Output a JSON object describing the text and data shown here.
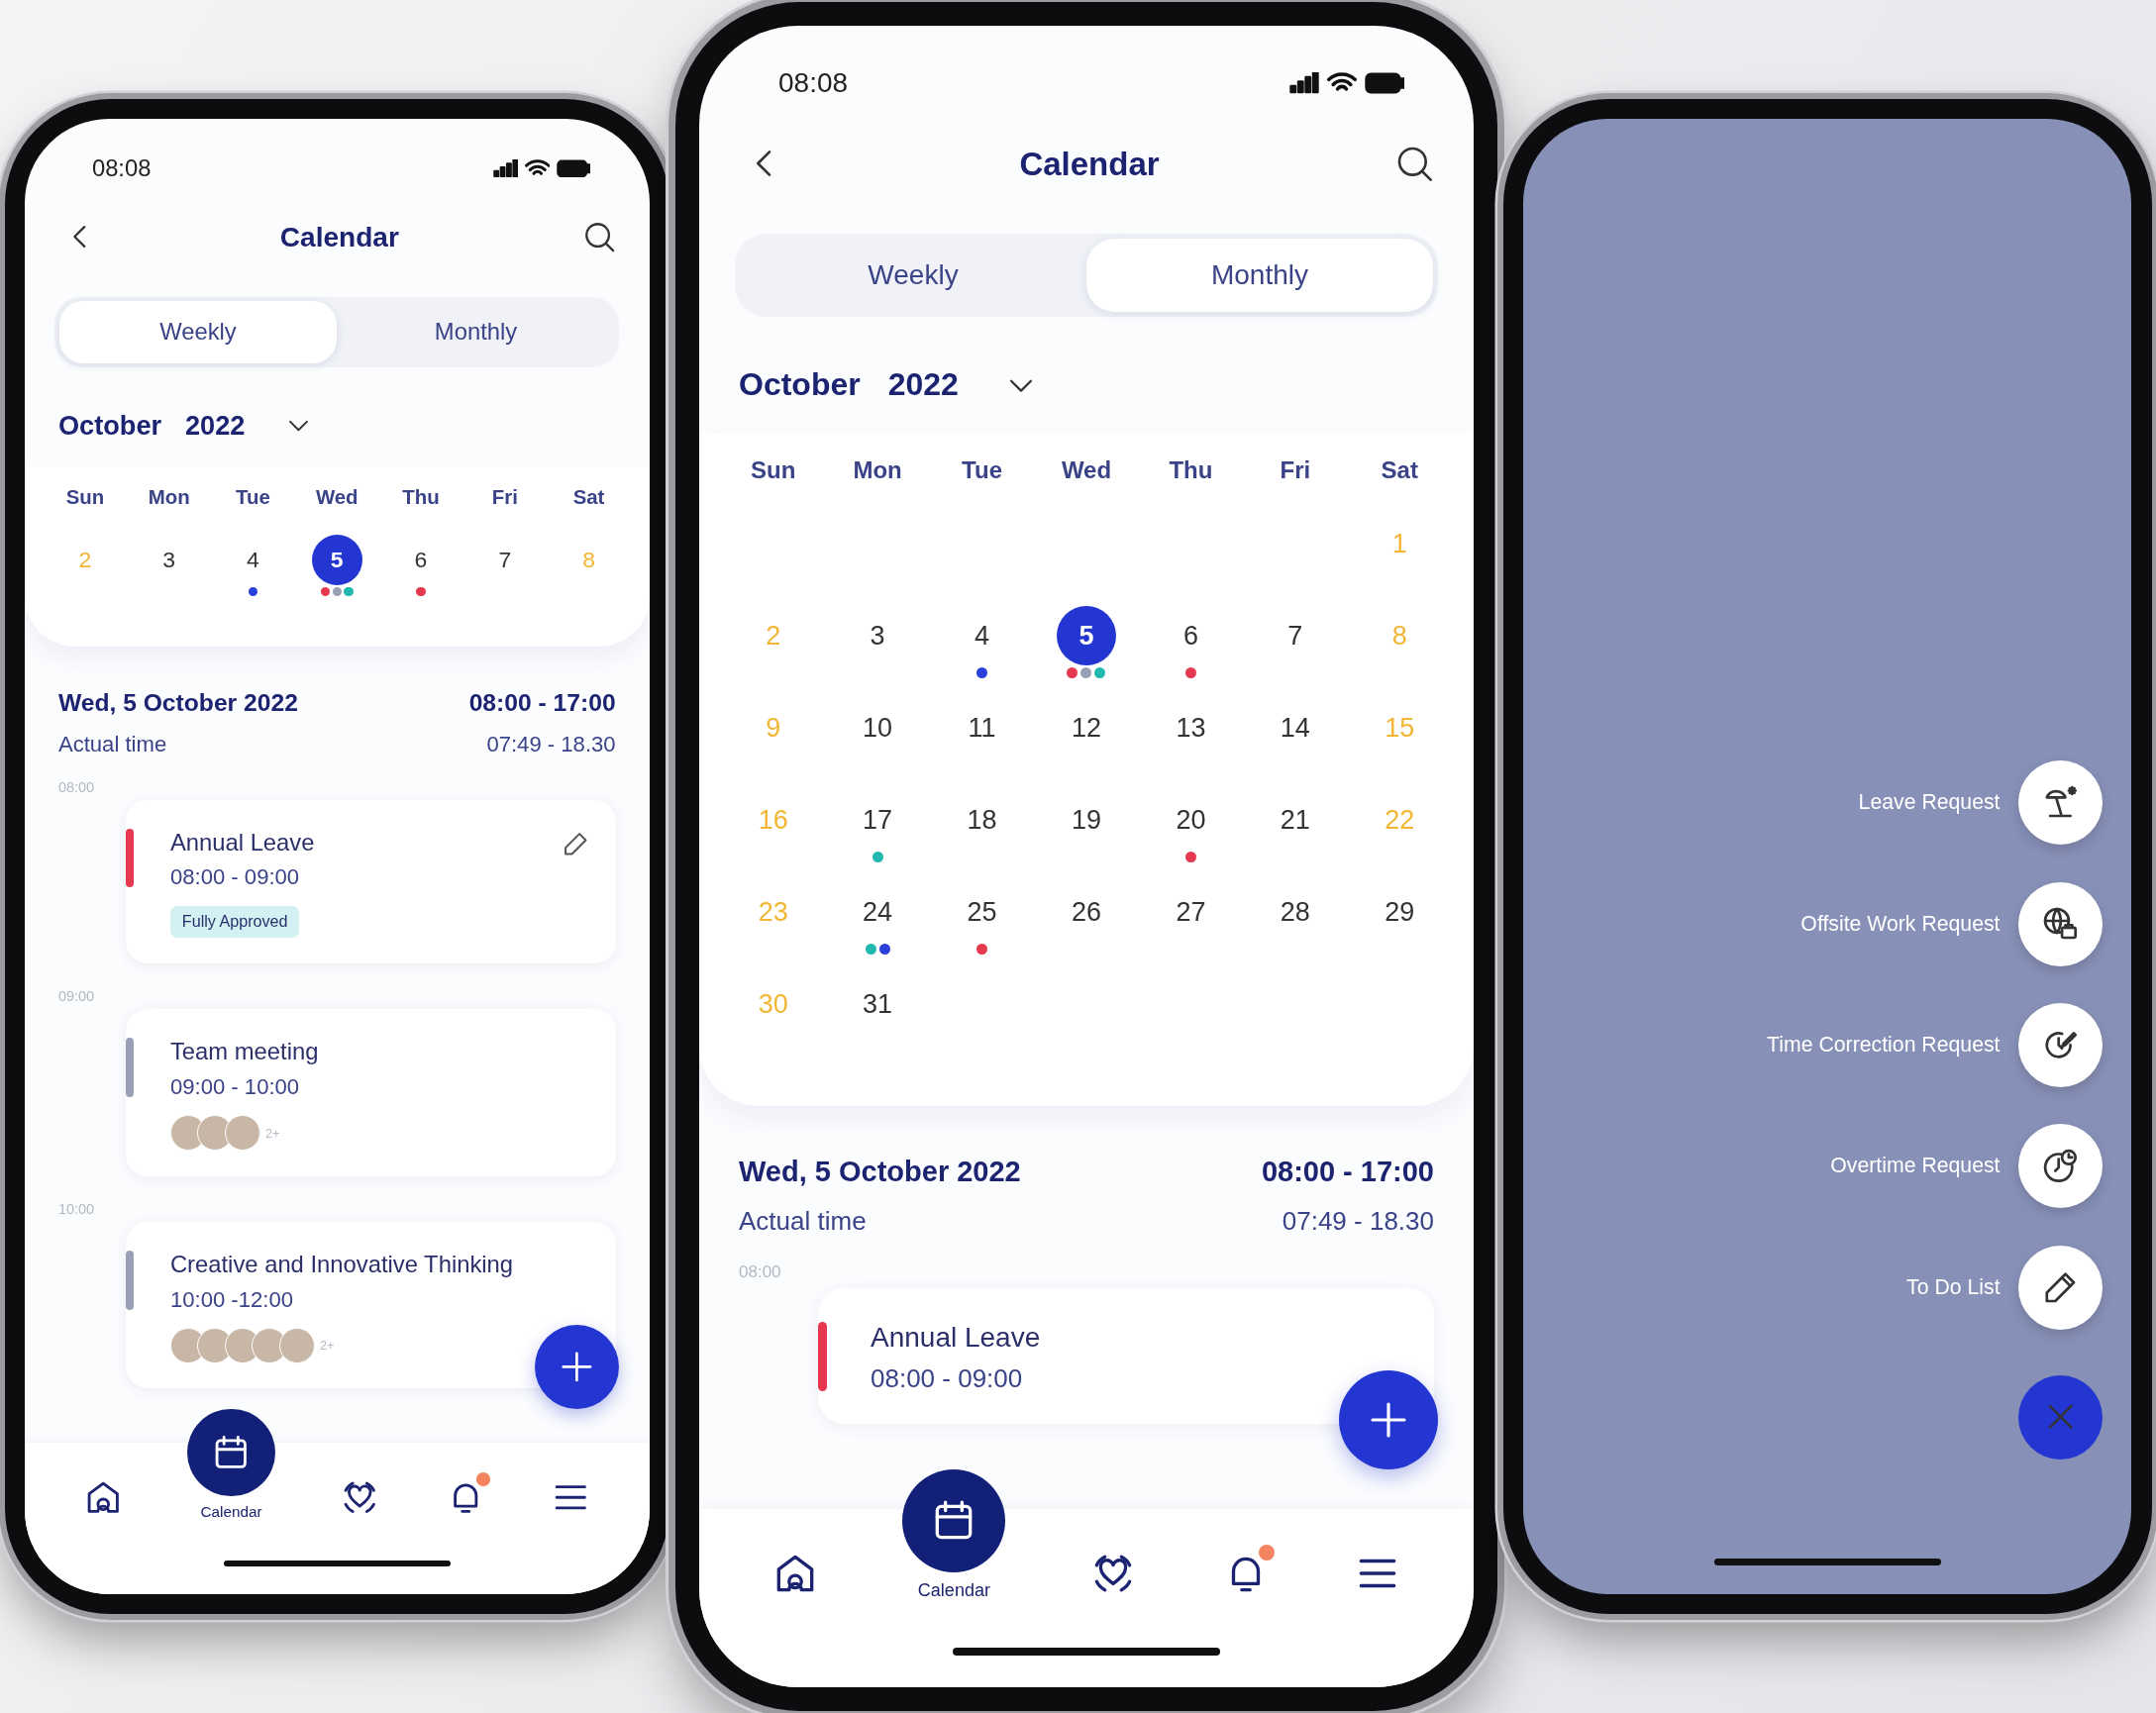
{
  "phones": [
    {
      "kind": "weekly",
      "status_time": "08:08",
      "title": "Calendar",
      "tabs": [
        {
          "label": "Weekly",
          "selected": true
        },
        {
          "label": "Monthly",
          "selected": false
        }
      ],
      "month": "October",
      "year": "2022",
      "weekdays": [
        "Sun",
        "Mon",
        "Tue",
        "Wed",
        "Thu",
        "Fri",
        "Sat"
      ],
      "weeks": [
        [
          {
            "kind": "day",
            "label": "2",
            "weekend": true,
            "selected": false
          },
          {
            "kind": "day",
            "label": "3",
            "weekend": false,
            "selected": false
          },
          {
            "kind": "day",
            "label": "4",
            "weekend": false,
            "selected": false,
            "dots": [
              {
                "color": "#2a40d8"
              }
            ]
          },
          {
            "kind": "day",
            "label": "5",
            "weekend": false,
            "selected": true,
            "dots": [
              {
                "color": "#e5394f"
              },
              {
                "color": "#9aa0b5"
              },
              {
                "color": "#21b8b0"
              }
            ]
          },
          {
            "kind": "day",
            "label": "6",
            "weekend": false,
            "selected": false,
            "dots": [
              {
                "color": "#e5394f"
              }
            ]
          },
          {
            "kind": "day",
            "label": "7",
            "weekend": false,
            "selected": false
          },
          {
            "kind": "day",
            "label": "8",
            "weekend": true,
            "selected": false
          }
        ]
      ],
      "day_title": "Wed, 5 October 2022",
      "planned": "08:00 - 17:00",
      "actual_label": "Actual time",
      "actual": "07:49 - 18.30",
      "schedule": [
        {
          "hour": "08:00",
          "title": "Annual Leave",
          "time": "08:00 - 09:00",
          "color": "#e5394f",
          "editable": true,
          "status": "Fully Approved"
        },
        {
          "hour": "09:00",
          "title": "Team meeting",
          "time": "09:00 - 10:00",
          "color": "#9aa0b5",
          "editable": false,
          "attendees": [
            {
              "kind": "photo"
            },
            {
              "kind": "photo"
            },
            {
              "kind": "photo"
            }
          ],
          "more": "2+"
        },
        {
          "hour": "10:00",
          "title": "Creative and Innovative Thinking",
          "time": "10:00 -12:00",
          "color": "#9aa0b6",
          "editable": false,
          "attendees": [
            {
              "kind": "photo"
            },
            {
              "kind": "photo"
            },
            {
              "kind": "photo"
            },
            {
              "kind": "photo"
            },
            {
              "kind": "photo"
            }
          ],
          "more": "2+"
        }
      ],
      "nav": [
        {
          "selected": false,
          "badge": false
        },
        {
          "selected": true,
          "badge": false,
          "label": "Calendar"
        },
        {
          "selected": false,
          "badge": false
        },
        {
          "selected": false,
          "badge": true
        },
        {
          "selected": false,
          "badge": false
        }
      ]
    },
    {
      "kind": "monthly",
      "status_time": "08:08",
      "title": "Calendar",
      "tabs": [
        {
          "label": "Weekly",
          "selected": false
        },
        {
          "label": "Monthly",
          "selected": true
        }
      ],
      "month": "October",
      "year": "2022",
      "weekdays": [
        "Sun",
        "Mon",
        "Tue",
        "Wed",
        "Thu",
        "Fri",
        "Sat"
      ],
      "weeks": [
        [
          {
            "kind": "blank"
          },
          {
            "kind": "blank"
          },
          {
            "kind": "blank"
          },
          {
            "kind": "blank"
          },
          {
            "kind": "blank"
          },
          {
            "kind": "blank"
          },
          {
            "kind": "day",
            "label": "1",
            "weekend": true,
            "selected": false
          }
        ],
        [
          {
            "kind": "day",
            "label": "2",
            "weekend": true,
            "selected": false
          },
          {
            "kind": "day",
            "label": "3",
            "weekend": false,
            "selected": false
          },
          {
            "kind": "day",
            "label": "4",
            "weekend": false,
            "selected": false,
            "dots": [
              {
                "color": "#2a40d8"
              }
            ]
          },
          {
            "kind": "day",
            "label": "5",
            "weekend": false,
            "selected": true,
            "dots": [
              {
                "color": "#e5394f"
              },
              {
                "color": "#9aa0b5"
              },
              {
                "color": "#21b8b0"
              }
            ]
          },
          {
            "kind": "day",
            "label": "6",
            "weekend": false,
            "selected": false,
            "dots": [
              {
                "color": "#e5394f"
              }
            ]
          },
          {
            "kind": "day",
            "label": "7",
            "weekend": false,
            "selected": false
          },
          {
            "kind": "day",
            "label": "8",
            "weekend": true,
            "selected": false
          }
        ],
        [
          {
            "kind": "day",
            "label": "9",
            "weekend": true,
            "selected": false
          },
          {
            "kind": "day",
            "label": "10",
            "weekend": false,
            "selected": false
          },
          {
            "kind": "day",
            "label": "11",
            "weekend": false,
            "selected": false
          },
          {
            "kind": "day",
            "label": "12",
            "weekend": false,
            "selected": false
          },
          {
            "kind": "day",
            "label": "13",
            "weekend": false,
            "selected": false
          },
          {
            "kind": "day",
            "label": "14",
            "weekend": false,
            "selected": false
          },
          {
            "kind": "day",
            "label": "15",
            "weekend": true,
            "selected": false
          }
        ],
        [
          {
            "kind": "day",
            "label": "16",
            "weekend": true,
            "selected": false
          },
          {
            "kind": "day",
            "label": "17",
            "weekend": false,
            "selected": false,
            "dots": [
              {
                "color": "#21b8b0"
              }
            ]
          },
          {
            "kind": "day",
            "label": "18",
            "weekend": false,
            "selected": false
          },
          {
            "kind": "day",
            "label": "19",
            "weekend": false,
            "selected": false
          },
          {
            "kind": "day",
            "label": "20",
            "weekend": false,
            "selected": false,
            "dots": [
              {
                "color": "#e5394f"
              }
            ]
          },
          {
            "kind": "day",
            "label": "21",
            "weekend": false,
            "selected": false
          },
          {
            "kind": "day",
            "label": "22",
            "weekend": true,
            "selected": false
          }
        ],
        [
          {
            "kind": "day",
            "label": "23",
            "weekend": true,
            "selected": false
          },
          {
            "kind": "day",
            "label": "24",
            "weekend": false,
            "selected": false,
            "dots": [
              {
                "color": "#21b8b0"
              },
              {
                "color": "#2a40d8"
              }
            ]
          },
          {
            "kind": "day",
            "label": "25",
            "weekend": false,
            "selected": false,
            "dots": [
              {
                "color": "#e5394f"
              }
            ]
          },
          {
            "kind": "day",
            "label": "26",
            "weekend": false,
            "selected": false
          },
          {
            "kind": "day",
            "label": "27",
            "weekend": false,
            "selected": false
          },
          {
            "kind": "day",
            "label": "28",
            "weekend": false,
            "selected": false
          },
          {
            "kind": "day",
            "label": "29",
            "weekend": false,
            "selected": false
          }
        ],
        [
          {
            "kind": "day",
            "label": "30",
            "weekend": true,
            "selected": false
          },
          {
            "kind": "day",
            "label": "31",
            "weekend": false,
            "selected": false
          }
        ]
      ],
      "day_title": "Wed, 5 October 2022",
      "planned": "08:00 - 17:00",
      "actual_label": "Actual time",
      "actual": "07:49 - 18.30",
      "schedule": [
        {
          "hour": "08:00",
          "title": "Annual Leave",
          "time": "08:00 - 09:00",
          "color": "#e5394f",
          "editable": false
        }
      ],
      "nav": [
        {
          "selected": false,
          "badge": false
        },
        {
          "selected": true,
          "badge": false,
          "label": "Calendar"
        },
        {
          "selected": false,
          "badge": false
        },
        {
          "selected": false,
          "badge": true
        },
        {
          "selected": false,
          "badge": false
        }
      ]
    },
    {
      "kind": "menu",
      "actions": [
        {
          "label": "Leave Request"
        },
        {
          "label": "Offsite Work Request"
        },
        {
          "label": "Time Correction Request"
        },
        {
          "label": "Overtime Request"
        },
        {
          "label": "To Do List"
        }
      ]
    }
  ]
}
